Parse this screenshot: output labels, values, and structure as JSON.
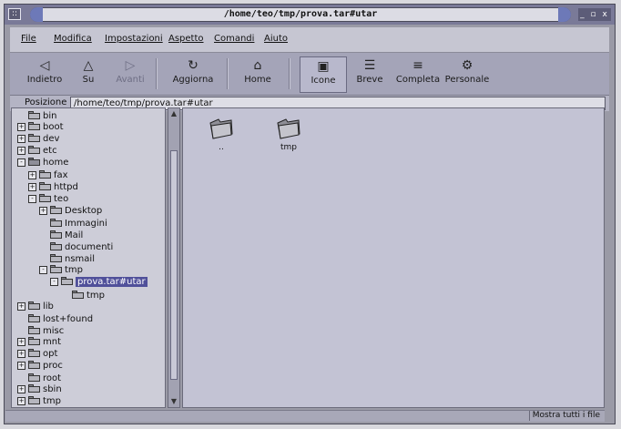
{
  "window": {
    "title": "/home/teo/tmp/prova.tar#utar",
    "menu_glyph": "::",
    "controls": "_ ▫ x"
  },
  "menu": [
    "File",
    "Modifica",
    "Impostazioni",
    "Aspetto",
    "Comandi",
    "Aiuto"
  ],
  "toolbar": {
    "back": "Indietro",
    "up": "Su",
    "forward": "Avanti",
    "reload": "Aggiorna",
    "home": "Home",
    "icons": "Icone",
    "brief": "Breve",
    "full": "Completa",
    "custom": "Personale"
  },
  "location": {
    "label": "Posizione",
    "value": "/home/teo/tmp/prova.tar#utar"
  },
  "tree": [
    {
      "label": "bin",
      "depth": 0,
      "expander": "none"
    },
    {
      "label": "boot",
      "depth": 0,
      "expander": "+"
    },
    {
      "label": "dev",
      "depth": 0,
      "expander": "+"
    },
    {
      "label": "etc",
      "depth": 0,
      "expander": "+"
    },
    {
      "label": "home",
      "depth": 0,
      "expander": "-",
      "icon": "home"
    },
    {
      "label": "fax",
      "depth": 1,
      "expander": "+"
    },
    {
      "label": "httpd",
      "depth": 1,
      "expander": "+"
    },
    {
      "label": "teo",
      "depth": 1,
      "expander": "-"
    },
    {
      "label": "Desktop",
      "depth": 2,
      "expander": "+"
    },
    {
      "label": "Immagini",
      "depth": 2,
      "expander": "none"
    },
    {
      "label": "Mail",
      "depth": 2,
      "expander": "none"
    },
    {
      "label": "documenti",
      "depth": 2,
      "expander": "none"
    },
    {
      "label": "nsmail",
      "depth": 2,
      "expander": "none"
    },
    {
      "label": "tmp",
      "depth": 2,
      "expander": "-"
    },
    {
      "label": "prova.tar#utar",
      "depth": 3,
      "expander": "-",
      "selected": true
    },
    {
      "label": "tmp",
      "depth": 4,
      "expander": "none"
    },
    {
      "label": "lib",
      "depth": 0,
      "expander": "+"
    },
    {
      "label": "lost+found",
      "depth": 0,
      "expander": "none"
    },
    {
      "label": "misc",
      "depth": 0,
      "expander": "none"
    },
    {
      "label": "mnt",
      "depth": 0,
      "expander": "+"
    },
    {
      "label": "opt",
      "depth": 0,
      "expander": "+"
    },
    {
      "label": "proc",
      "depth": 0,
      "expander": "+"
    },
    {
      "label": "root",
      "depth": 0,
      "expander": "none"
    },
    {
      "label": "sbin",
      "depth": 0,
      "expander": "+"
    },
    {
      "label": "tmp",
      "depth": 0,
      "expander": "+"
    }
  ],
  "files": [
    {
      "name": "..",
      "icon": "folder-up-icon"
    },
    {
      "name": "tmp",
      "icon": "folder-icon"
    }
  ],
  "status": {
    "show_all": "Mostra tutti i file"
  },
  "colors": {
    "selection": "#50509a",
    "window_frame": "#9a9aa6",
    "pane": "#c3c3d4"
  }
}
